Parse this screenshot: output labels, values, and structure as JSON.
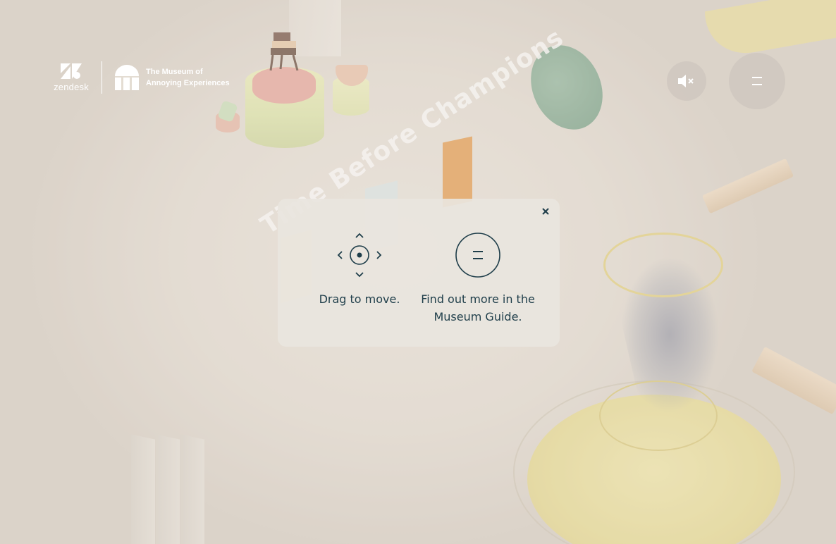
{
  "brand": {
    "partner": "zendesk",
    "title_line1": "The Museum of",
    "title_line2": "Annoying Experiences"
  },
  "scene": {
    "floor_text": "Time Before Champions"
  },
  "controls": {
    "sound_icon": "speaker-muted-icon",
    "menu_icon": "menu-icon"
  },
  "modal": {
    "close_icon": "close-icon",
    "hints": [
      {
        "icon": "drag-move-icon",
        "text": "Drag to move."
      },
      {
        "icon": "menu-circle-icon",
        "text": "Find out more in the Museum Guide."
      }
    ]
  },
  "colors": {
    "text_dark": "#1f3e4a",
    "modal_bg": "#e9e5de",
    "white": "#ffffff"
  }
}
